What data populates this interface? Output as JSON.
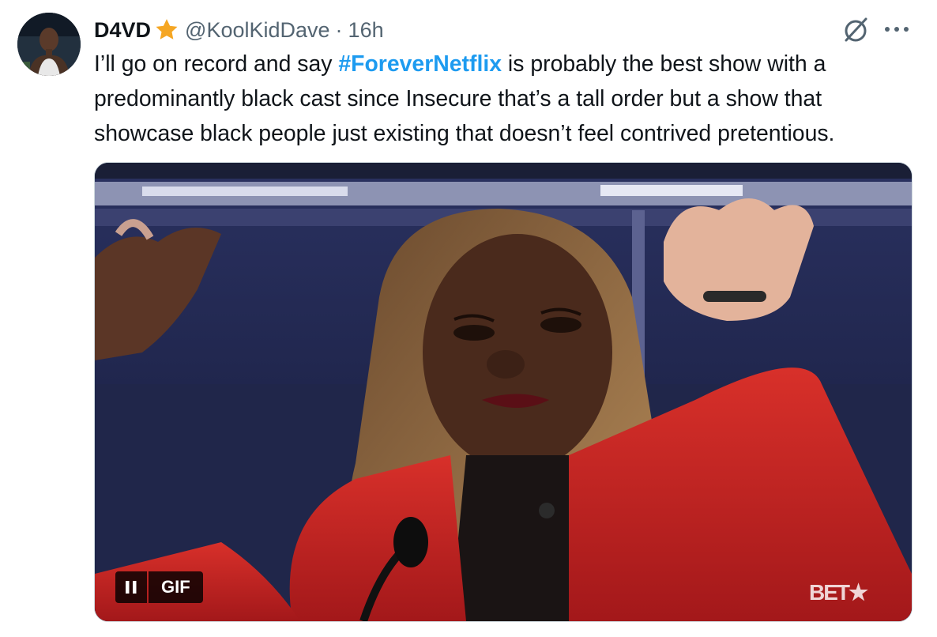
{
  "author": {
    "display_name": "D4VD",
    "handle": "@KoolKidDave",
    "separator": "·",
    "time": "16h",
    "verified_icon": "star-icon",
    "verified_color": "#f5a623"
  },
  "tweet": {
    "lines": [
      {
        "pre": "I’ll go on record and say ",
        "hashtag": "#ForeverNetflix",
        "post": " is probably the best show with a"
      },
      {
        "text": "predominantly black cast since Insecure that’s a tall order but a show that"
      },
      {
        "text": "showcase black people just existing that doesn’t feel contrived pretentious."
      }
    ]
  },
  "media": {
    "type": "gif",
    "gif_badge": "GIF",
    "watermark": "BET★",
    "pause_icon": "pause-icon"
  },
  "icons": {
    "grok": "grok-icon",
    "more": "more-dots-icon"
  },
  "colors": {
    "text": "#0f1419",
    "secondary": "#536471",
    "link": "#1d9bf0",
    "jacket": "#c8211f"
  }
}
